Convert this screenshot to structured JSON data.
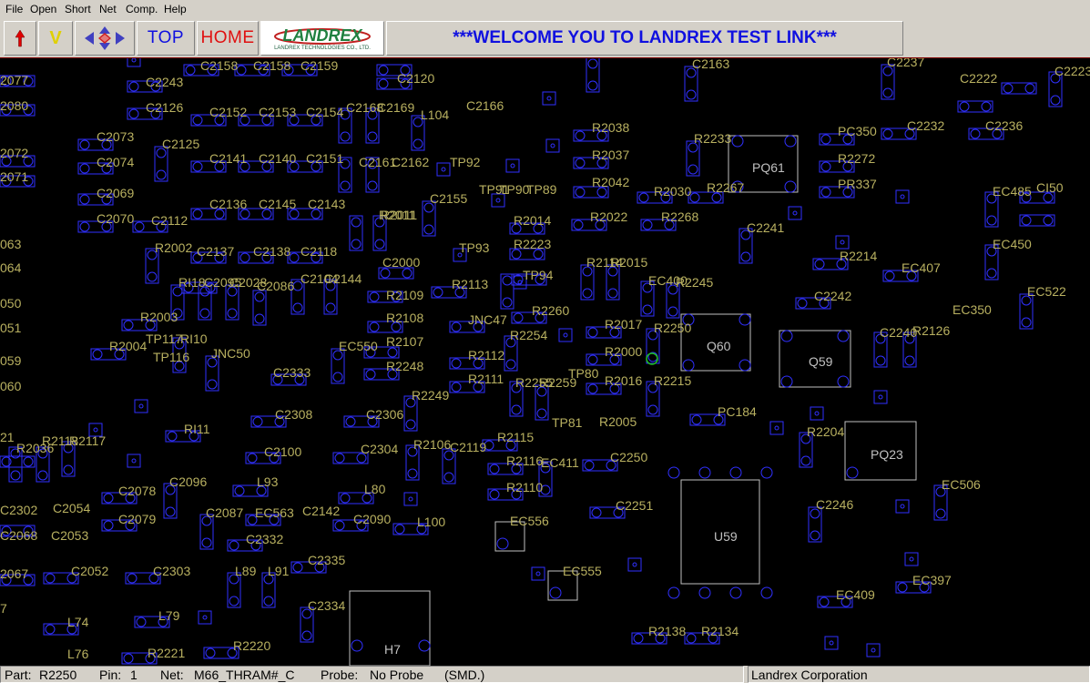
{
  "menu": [
    "File",
    "Open",
    "Short",
    "Net",
    "Comp.",
    "Help"
  ],
  "toolbar": {
    "top_label": "TOP",
    "home_label": "HOME",
    "logo_text": "LANDREX",
    "logo_sub": "LANDREX TECHNOLOGIES CO., LTD.",
    "welcome": "***WELCOME YOU TO LANDREX TEST LINK***",
    "v_label": "V"
  },
  "colors": {
    "board_bg": "#000000",
    "pad": "#3030ff",
    "label": "#b8b060",
    "outline": "#c0c0c0",
    "highlight": "#20c020",
    "top_text": "#1010e0",
    "home_text": "#e01010"
  },
  "board_labels": [
    "2077",
    "C2158",
    "C2158",
    "C2159",
    "C2163",
    "C2237",
    "C2223",
    "C2243",
    "C2120",
    "C2222",
    "2080",
    "C2126",
    "C2152",
    "C2153",
    "C2154",
    "C2168",
    "C2169",
    "L104",
    "C2166",
    "R2038",
    "C2232",
    "C2236",
    "C2073",
    "C2125",
    "PC350",
    "R2233",
    "2072",
    "C2074",
    "C2141",
    "C2140",
    "C2151",
    "C2161",
    "C2162",
    "TP92",
    "R2037",
    "PQ61",
    "R2272",
    "2071",
    "C2069",
    "R2042",
    "R2030",
    "R2267",
    "PR337",
    "EC485",
    "CI50",
    "C2136",
    "C2145",
    "C2143",
    "C2155",
    "TP91",
    "TP90",
    "TP89",
    "C2070",
    "C2112",
    "R2011",
    "R2014",
    "R2022",
    "R2268",
    "C2241",
    "R2002",
    "C2137",
    "C2138",
    "C2118",
    "TP93",
    "R2223",
    "EC450",
    "063",
    "R2214",
    "064",
    "C2000",
    "TP94",
    "R2114",
    "R2015",
    "EC407",
    "C2144",
    "C2104",
    "RI18",
    "C2095",
    "C2028",
    "C2086",
    "R2113",
    "R2011",
    "EC400",
    "R2245",
    "EC522",
    "050",
    "R2109",
    "C2242",
    "R2003",
    "R2108",
    "JNC47",
    "R2260",
    "EC350",
    "051",
    "TP117",
    "RI10",
    "R2107",
    "R2254",
    "R2017",
    "R2250",
    "Q60",
    "C2240",
    "R2126",
    "R2004",
    "JNC50",
    "EC550",
    "R2112",
    "R2000",
    "Q59",
    "059",
    "TP116",
    "C2333",
    "R2248",
    "R2111",
    "R2255",
    "R2259",
    "TP80",
    "R2016",
    "R2215",
    "060",
    "R2249",
    "C2308",
    "C2306",
    "PC184",
    "RI11",
    "TP81",
    "R2005",
    "R2204",
    "21",
    "R2118",
    "R2117",
    "R2036",
    "C2100",
    "R2106",
    "C2304",
    "C2119",
    "R2115",
    "R2116",
    "EC411",
    "C2250",
    "PQ23",
    "C2096",
    "L93",
    "R2110",
    "EC506",
    "C2078",
    "L80",
    "C2087",
    "EC563",
    "C2142",
    "C2302",
    "C2054",
    "C2251",
    "U59",
    "C2246",
    "C2079",
    "C2090",
    "L100",
    "EC556",
    "C2068",
    "C2053",
    "C2332",
    "C2335",
    "2067",
    "C2052",
    "C2303",
    "L89",
    "L91",
    "EC555",
    "EC397",
    "C2334",
    "EC409",
    "L74",
    "L79",
    "H7",
    "R2138",
    "R2134",
    "L76",
    "R2221",
    "R2220",
    "7"
  ],
  "status": {
    "part_label": "Part:",
    "part_value": "R2250",
    "pin_label": "Pin:",
    "pin_value": "1",
    "net_label": "Net:",
    "net_value": "M66_THRAM#_C",
    "probe_label": "Probe:",
    "probe_value": "No Probe",
    "type_value": "(SMD.)",
    "company": "Landrex Corporation"
  }
}
